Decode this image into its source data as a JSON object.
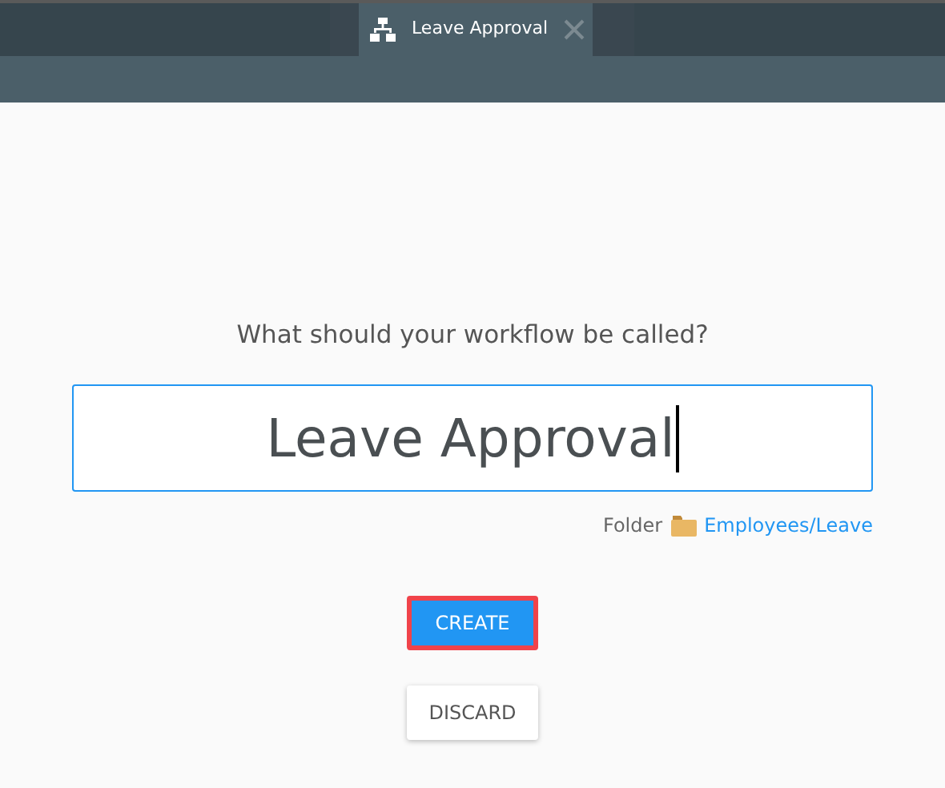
{
  "tab": {
    "title": "Leave Approval",
    "selected": true
  },
  "prompt": "What should your workflow be called?",
  "name_field": {
    "value": "Leave Approval",
    "focused": true
  },
  "folder": {
    "label": "Folder",
    "path": "Employees/Leave"
  },
  "buttons": [
    {
      "label": "CREATE",
      "kind": "primary",
      "highlighted": true
    },
    {
      "label": "DISCARD",
      "kind": "secondary",
      "highlighted": false
    }
  ]
}
